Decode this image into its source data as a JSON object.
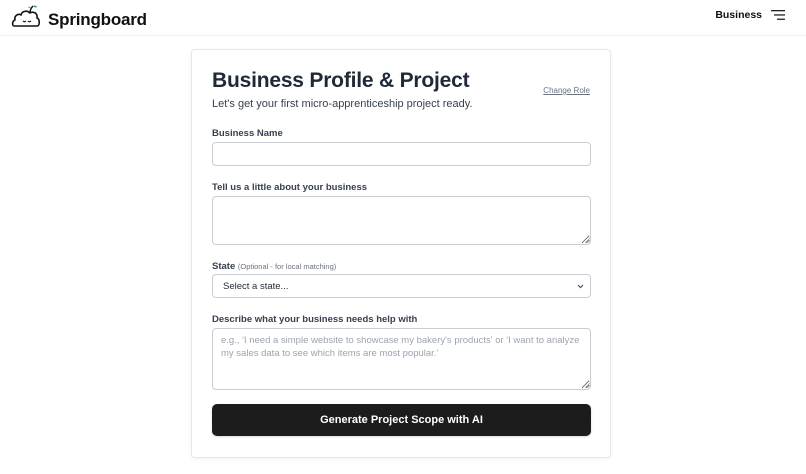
{
  "header": {
    "brand_name": "Springboard",
    "logo_icon": "cloud-sprout-logo",
    "role_label": "Business",
    "menu_icon": "hamburger-menu-icon"
  },
  "form": {
    "title": "Business Profile & Project",
    "change_role_link": "Change Role",
    "subtitle": "Let's get your first micro-apprenticeship project ready.",
    "business_name": {
      "label": "Business Name",
      "value": ""
    },
    "about": {
      "label": "Tell us a little about your business",
      "value": ""
    },
    "state": {
      "label": "State",
      "hint": "(Optional - for local matching)",
      "selected": "Select a state..."
    },
    "needs": {
      "label": "Describe what your business needs help with",
      "placeholder": "e.g., 'I need a simple website to showcase my bakery's products' or 'I want to analyze my sales data to see which items are most popular.'",
      "value": ""
    },
    "submit_label": "Generate Project Scope with AI"
  }
}
